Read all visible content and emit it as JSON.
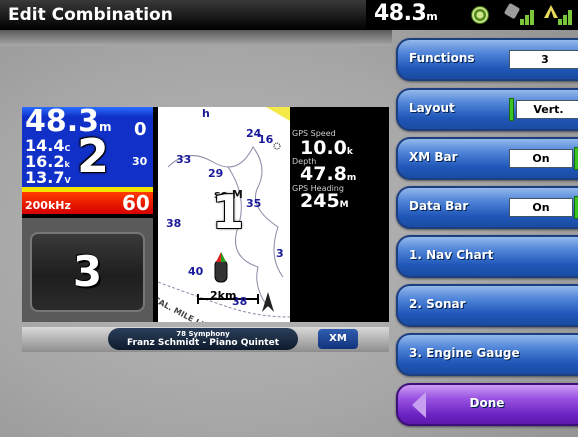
{
  "title": "Edit Combination",
  "status": {
    "depth_value": "48.3",
    "depth_unit": "m"
  },
  "preview": {
    "sonar": {
      "depth": "48.3",
      "depth_unit": "m",
      "row1": "14.4",
      "row1_unit": "C",
      "row2": "16.2",
      "row2_unit": "k",
      "row3": "13.7",
      "row3_unit": "V",
      "scale_top": "0",
      "scale_mid": "30",
      "scale_bottom": "60",
      "frequency": "200kHz",
      "pane_number": "2"
    },
    "gauge": {
      "pane_number": "3"
    },
    "chart": {
      "pane_number": "1",
      "soundings": [
        "h",
        "24",
        "16",
        "33",
        "29",
        "38",
        "35",
        "40",
        "38",
        "3"
      ],
      "so_label": "so M",
      "scale": "2km",
      "line_label": "CAL. MILE LINE"
    },
    "data_bar": [
      {
        "label": "GPS Speed",
        "value": "10.0",
        "unit": "k"
      },
      {
        "label": "Depth",
        "value": "47.8",
        "unit": "m"
      },
      {
        "label": "GPS Heading",
        "value": "245",
        "unit": "M"
      }
    ],
    "xm": {
      "song_title": "78 Symphony",
      "artist": "Franz Schmidt - Piano Quintet",
      "button": "XM"
    }
  },
  "menu": {
    "functions": {
      "label": "Functions",
      "value": "3"
    },
    "layout": {
      "label": "Layout",
      "value": "Vert."
    },
    "xm_bar": {
      "label": "XM Bar",
      "value": "On"
    },
    "data_bar": {
      "label": "Data Bar",
      "value": "On"
    },
    "nav_chart": {
      "label": "1. Nav Chart"
    },
    "sonar": {
      "label": "2. Sonar"
    },
    "engine_gauge": {
      "label": "3. Engine Gauge"
    },
    "done": {
      "label": "Done"
    }
  },
  "colors": {
    "menu_blue": "#2057b8",
    "done_purple": "#6a22c0",
    "toggle_green": "#39c424"
  }
}
